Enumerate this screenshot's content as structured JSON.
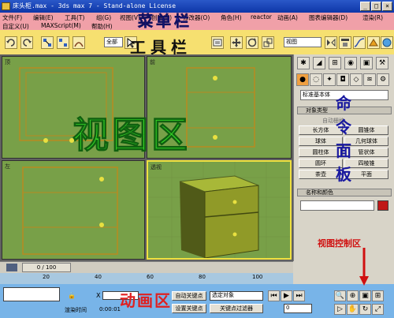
{
  "window": {
    "title": "床头柜.max - 3ds max 7 - Stand-alone License",
    "controls": [
      "_",
      "□",
      "×"
    ]
  },
  "menu": {
    "row1": [
      "文件(F)",
      "编辑(E)",
      "工具(T)",
      "组(G)",
      "视图(V)",
      "创建(C)",
      "修改器(O)",
      "角色(H)",
      "reactor",
      "动画(A)",
      "图表编辑器(D)",
      "渲染(R)"
    ],
    "row2": [
      "自定义(U)",
      "MAXScript(M)",
      "帮助(H)"
    ],
    "overlay": "菜单栏"
  },
  "toolbar": {
    "overlay": "工具栏",
    "selection_filter": "全部",
    "coord_system": "视图",
    "icons": [
      "undo-icon",
      "redo-icon",
      "link-icon",
      "unlink-icon",
      "bind-icon",
      "select-icon",
      "select-by-name-icon",
      "move-icon",
      "rotate-icon",
      "scale-icon",
      "mirror-icon",
      "align-icon",
      "layer-icon",
      "curve-editor-icon",
      "render-icon",
      "quick-render-icon"
    ]
  },
  "viewports": {
    "overlay": "视图区",
    "labels": [
      "顶",
      "前",
      "左",
      "透视"
    ]
  },
  "command_panel": {
    "overlay": "命令面板",
    "category": "标准基本体",
    "rollout_object_type": "对象类型",
    "autogrid": "自动栅格",
    "primitives": [
      "长方体",
      "圆锥体",
      "球体",
      "几何球体",
      "圆柱体",
      "管状体",
      "圆环",
      "四棱锥",
      "茶壶",
      "平面"
    ],
    "rollout_name_color": "名称和颜色",
    "swatch_color": "#c01818"
  },
  "timeline": {
    "frame_counter": "0 / 100",
    "ticks": [
      "0",
      "20",
      "40",
      "60",
      "80",
      "100"
    ]
  },
  "status": {
    "anim_overlay": "动画区",
    "viewctrl_overlay": "视图控制区",
    "x_label": "X",
    "auto_key": "自动关键点",
    "set_key": "设置关键点",
    "selected_dropdown": "选定对象",
    "key_filters": "关键点过滤器",
    "render_time_label": "渲染时间",
    "render_time_value": "0:00:01",
    "frame_field": "0"
  }
}
